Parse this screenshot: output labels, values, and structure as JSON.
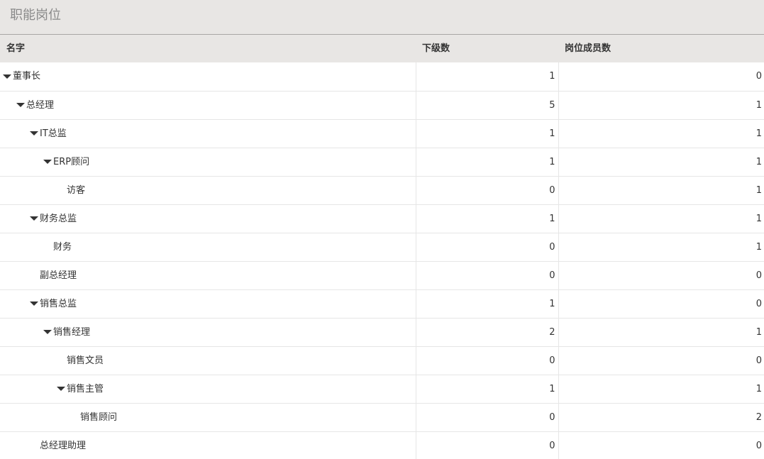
{
  "page": {
    "title": "职能岗位"
  },
  "table": {
    "columns": {
      "name": "名字",
      "subordinates": "下级数",
      "members": "岗位成员数"
    },
    "rows": [
      {
        "name": "董事长",
        "level": 0,
        "expanded": true,
        "subordinates": "1",
        "members": "0"
      },
      {
        "name": "总经理",
        "level": 1,
        "expanded": true,
        "subordinates": "5",
        "members": "1"
      },
      {
        "name": "IT总监",
        "level": 2,
        "expanded": true,
        "subordinates": "1",
        "members": "1"
      },
      {
        "name": "ERP顾问",
        "level": 3,
        "expanded": true,
        "subordinates": "1",
        "members": "1"
      },
      {
        "name": "访客",
        "level": 4,
        "expanded": false,
        "subordinates": "0",
        "members": "1"
      },
      {
        "name": "财务总监",
        "level": 2,
        "expanded": true,
        "subordinates": "1",
        "members": "1"
      },
      {
        "name": "财务",
        "level": 3,
        "expanded": false,
        "subordinates": "0",
        "members": "1"
      },
      {
        "name": "副总经理",
        "level": 2,
        "expanded": false,
        "subordinates": "0",
        "members": "0"
      },
      {
        "name": "销售总监",
        "level": 2,
        "expanded": true,
        "subordinates": "1",
        "members": "0"
      },
      {
        "name": "销售经理",
        "level": 3,
        "expanded": true,
        "subordinates": "2",
        "members": "1"
      },
      {
        "name": "销售文员",
        "level": 4,
        "expanded": false,
        "subordinates": "0",
        "members": "0"
      },
      {
        "name": "销售主管",
        "level": 4,
        "expanded": true,
        "subordinates": "1",
        "members": "1"
      },
      {
        "name": "销售顾问",
        "level": 5,
        "expanded": false,
        "subordinates": "0",
        "members": "2"
      },
      {
        "name": "总经理助理",
        "level": 2,
        "expanded": false,
        "subordinates": "0",
        "members": "0"
      }
    ]
  }
}
